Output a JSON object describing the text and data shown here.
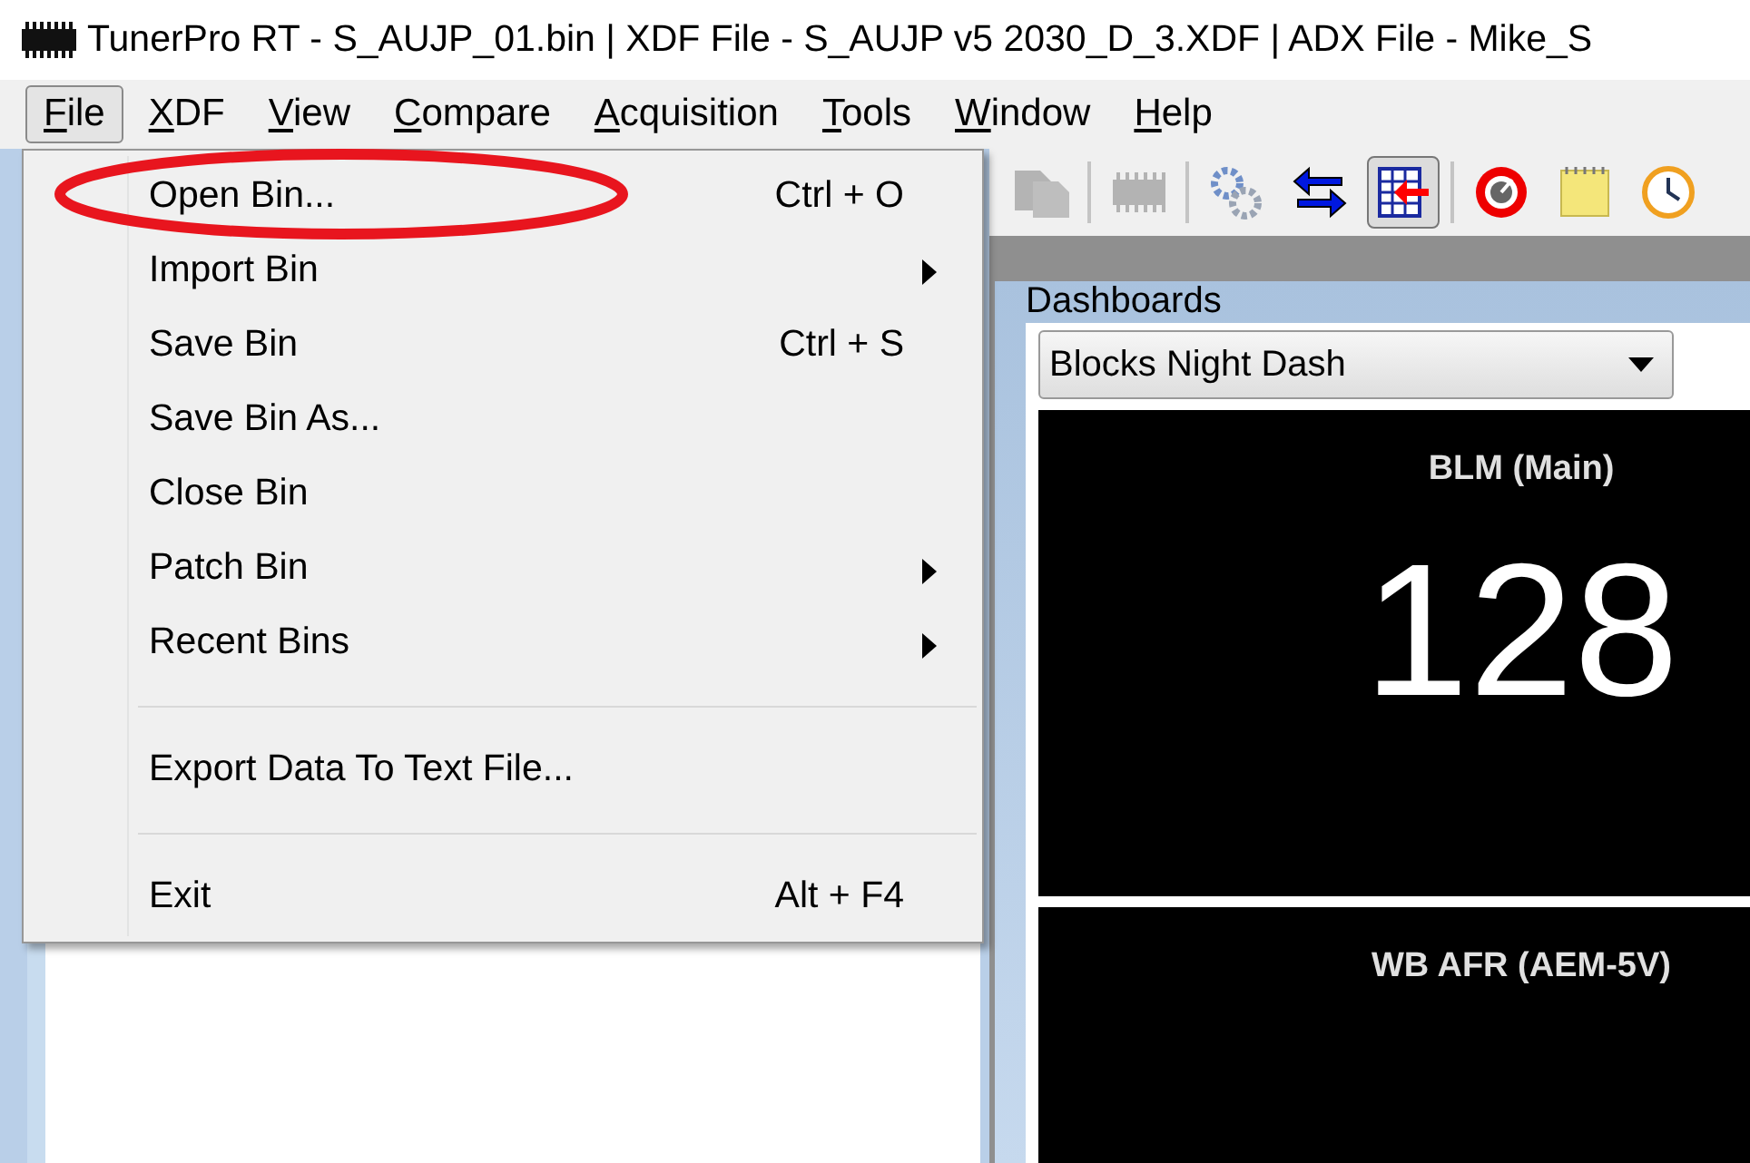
{
  "window": {
    "title": "TunerPro RT - S_AUJP_01.bin | XDF File - S_AUJP v5 2030_D_3.XDF | ADX File - Mike_S"
  },
  "menu_bar": [
    {
      "label": "File",
      "selected": true
    },
    {
      "label": "XDF",
      "selected": false
    },
    {
      "label": "View",
      "selected": false
    },
    {
      "label": "Compare",
      "selected": false
    },
    {
      "label": "Acquisition",
      "selected": false
    },
    {
      "label": "Tools",
      "selected": false
    },
    {
      "label": "Window",
      "selected": false
    },
    {
      "label": "Help",
      "selected": false
    }
  ],
  "file_menu": [
    {
      "kind": "item",
      "label": "Open Bin...",
      "shortcut": "Ctrl + O",
      "submenu": false,
      "circled": true
    },
    {
      "kind": "item",
      "label": "Import Bin",
      "submenu": true,
      "circled": false
    },
    {
      "kind": "item",
      "label": "Save Bin",
      "shortcut": "Ctrl + S",
      "submenu": false,
      "circled": false
    },
    {
      "kind": "item",
      "label": "Save Bin As...",
      "submenu": false,
      "circled": false
    },
    {
      "kind": "item",
      "label": "Close Bin",
      "submenu": false,
      "circled": false
    },
    {
      "kind": "item",
      "label": "Patch Bin",
      "submenu": true,
      "circled": false
    },
    {
      "kind": "item",
      "label": "Recent Bins",
      "submenu": true,
      "circled": false
    },
    {
      "kind": "separator"
    },
    {
      "kind": "item",
      "label": "Export Data To Text File...",
      "submenu": false,
      "circled": false
    },
    {
      "kind": "separator"
    },
    {
      "kind": "item",
      "label": "Exit",
      "shortcut": "Alt + F4",
      "submenu": false,
      "circled": false
    }
  ],
  "toolbar": [
    {
      "kind": "pages",
      "disabled": true,
      "pressed": false
    },
    {
      "kind": "separator"
    },
    {
      "kind": "chip",
      "disabled": true,
      "pressed": false
    },
    {
      "kind": "separator"
    },
    {
      "kind": "gears",
      "disabled": false,
      "pressed": false
    },
    {
      "kind": "swap",
      "disabled": false,
      "pressed": false
    },
    {
      "kind": "table",
      "disabled": false,
      "pressed": true
    },
    {
      "kind": "separator"
    },
    {
      "kind": "gauge",
      "disabled": false,
      "pressed": false
    },
    {
      "kind": "notepad",
      "disabled": false,
      "pressed": false
    },
    {
      "kind": "clock",
      "disabled": false,
      "pressed": false
    }
  ],
  "dashboards": {
    "title": "Dashboards",
    "selector": {
      "value": "Blocks Night Dash"
    },
    "gauges": [
      {
        "label": "BLM (Main)",
        "value": "128"
      },
      {
        "label": "WB AFR (AEM-5V)"
      }
    ]
  }
}
